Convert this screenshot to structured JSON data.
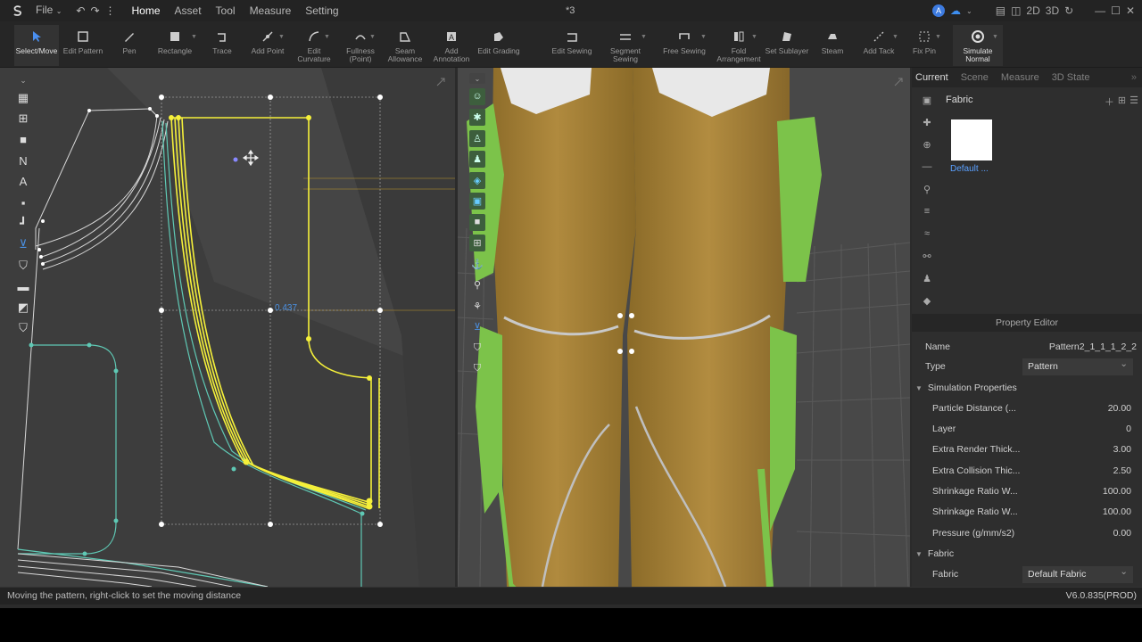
{
  "menubar": {
    "items": [
      "File",
      "Home",
      "Asset",
      "Tool",
      "Measure",
      "Setting"
    ],
    "active": "Home",
    "title": "*3",
    "mode_2d": "2D",
    "mode_3d": "3D",
    "avatar_letter": "A"
  },
  "toolbar": {
    "tools": [
      {
        "label": "Select/Move",
        "icon": "select-arrow-icon"
      },
      {
        "label": "Edit Pattern",
        "icon": "edit-pattern-icon"
      },
      {
        "label": "Pen",
        "icon": "pen-icon"
      },
      {
        "label": "Rectangle",
        "icon": "rectangle-icon"
      },
      {
        "label": "Trace",
        "icon": "trace-icon"
      },
      {
        "label": "Add Point",
        "icon": "add-point-icon"
      },
      {
        "label": "Edit\nCurvature",
        "icon": "edit-curvature-icon"
      },
      {
        "label": "Fullness\n(Point)",
        "icon": "fullness-icon"
      },
      {
        "label": "Seam\nAllowance",
        "icon": "seam-allowance-icon"
      },
      {
        "label": "Add\nAnnotation",
        "icon": "annotation-icon"
      },
      {
        "label": "Edit Grading",
        "icon": "edit-grading-icon"
      },
      {
        "label": "Edit Sewing",
        "icon": "edit-sewing-icon"
      },
      {
        "label": "Segment\nSewing",
        "icon": "segment-sewing-icon"
      },
      {
        "label": "Free Sewing",
        "icon": "free-sewing-icon"
      },
      {
        "label": "Fold\nArrangement",
        "icon": "fold-arrangement-icon"
      },
      {
        "label": "Set Sublayer",
        "icon": "sublayer-icon"
      },
      {
        "label": "Steam",
        "icon": "steam-icon"
      },
      {
        "label": "Add Tack",
        "icon": "add-tack-icon"
      },
      {
        "label": "Fix Pin",
        "icon": "fix-pin-icon"
      },
      {
        "label": "Simulate\nNormal",
        "icon": "simulate-icon"
      }
    ]
  },
  "viewport2d": {
    "measure": "0.437"
  },
  "panel": {
    "tabs": [
      "Current",
      "Scene",
      "Measure",
      "3D State"
    ],
    "active_tab": "Current",
    "section": "Fabric",
    "swatch_label": "Default ..."
  },
  "property_editor": {
    "title": "Property Editor",
    "name_label": "Name",
    "name_value": "Pattern2_1_1_1_2_2",
    "type_label": "Type",
    "type_value": "Pattern",
    "sim_header": "Simulation Properties",
    "rows": [
      {
        "k": "Particle Distance (...",
        "v": "20.00"
      },
      {
        "k": "Layer",
        "v": "0"
      },
      {
        "k": "Extra Render Thick...",
        "v": "3.00"
      },
      {
        "k": "Extra Collision Thic...",
        "v": "2.50"
      },
      {
        "k": "Shrinkage Ratio W...",
        "v": "100.00"
      },
      {
        "k": "Shrinkage Ratio W...",
        "v": "100.00"
      },
      {
        "k": "Pressure (g/mm/s2)",
        "v": "0.00"
      }
    ],
    "fabric_header": "Fabric",
    "fabric_label": "Fabric",
    "fabric_value": "Default Fabric"
  },
  "status": {
    "message": "Moving the pattern, right-click to set the moving distance",
    "version": "V6.0.835(PROD)"
  },
  "colors": {
    "selected_pattern": "#f5f03a",
    "pattern_outline": "#5fc9b5",
    "fabric_main": "#a9843a",
    "fabric_green": "#7cc34a"
  }
}
